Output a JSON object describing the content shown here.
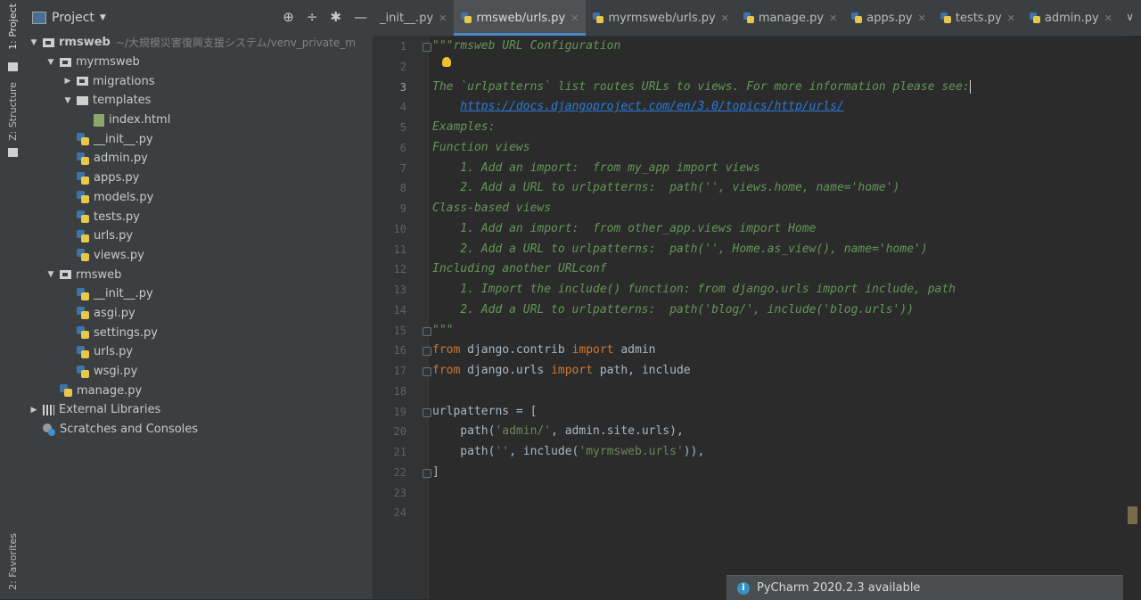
{
  "side_tabs": {
    "project": "1: Project",
    "structure": "Z: Structure",
    "favorites": "2: Favorites"
  },
  "project_panel": {
    "title": "Project",
    "tree": [
      {
        "label": "rmsweb",
        "suffix": "~/大規模災害復興支援システム/venv_private_m",
        "depth": 0,
        "arrow": "down",
        "icon": "folder",
        "bold": true
      },
      {
        "label": "myrmsweb",
        "depth": 1,
        "arrow": "down",
        "icon": "folder"
      },
      {
        "label": "migrations",
        "depth": 2,
        "arrow": "right",
        "icon": "folder"
      },
      {
        "label": "templates",
        "depth": 2,
        "arrow": "down",
        "icon": "folder-plain"
      },
      {
        "label": "index.html",
        "depth": 3,
        "icon": "html"
      },
      {
        "label": "__init__.py",
        "depth": 2,
        "icon": "py"
      },
      {
        "label": "admin.py",
        "depth": 2,
        "icon": "py"
      },
      {
        "label": "apps.py",
        "depth": 2,
        "icon": "py"
      },
      {
        "label": "models.py",
        "depth": 2,
        "icon": "py"
      },
      {
        "label": "tests.py",
        "depth": 2,
        "icon": "py"
      },
      {
        "label": "urls.py",
        "depth": 2,
        "icon": "py"
      },
      {
        "label": "views.py",
        "depth": 2,
        "icon": "py"
      },
      {
        "label": "rmsweb",
        "depth": 1,
        "arrow": "down",
        "icon": "folder"
      },
      {
        "label": "__init__.py",
        "depth": 2,
        "icon": "py"
      },
      {
        "label": "asgi.py",
        "depth": 2,
        "icon": "py"
      },
      {
        "label": "settings.py",
        "depth": 2,
        "icon": "py"
      },
      {
        "label": "urls.py",
        "depth": 2,
        "icon": "py"
      },
      {
        "label": "wsgi.py",
        "depth": 2,
        "icon": "py"
      },
      {
        "label": "manage.py",
        "depth": 1,
        "icon": "py"
      },
      {
        "label": "External Libraries",
        "depth": 0,
        "arrow": "right",
        "icon": "lib"
      },
      {
        "label": "Scratches and Consoles",
        "depth": 0,
        "icon": "scratch"
      }
    ]
  },
  "tabs": [
    {
      "label": "_init__.py",
      "icon": false,
      "active": false
    },
    {
      "label": "rmsweb/urls.py",
      "icon": true,
      "active": true
    },
    {
      "label": "myrmsweb/urls.py",
      "icon": true,
      "active": false
    },
    {
      "label": "manage.py",
      "icon": true,
      "active": false
    },
    {
      "label": "apps.py",
      "icon": true,
      "active": false
    },
    {
      "label": "tests.py",
      "icon": true,
      "active": false
    },
    {
      "label": "admin.py",
      "icon": true,
      "active": false
    }
  ],
  "editor": {
    "current_line": 3,
    "lines": [
      [
        {
          "t": "\"\"\"rmsweb URL Configuration",
          "c": "doc"
        }
      ],
      [],
      [
        {
          "t": "The `urlpatterns` list routes URLs to views. For more information please see:",
          "c": "doc"
        },
        {
          "t": "",
          "c": "caret"
        }
      ],
      [
        {
          "t": "    ",
          "c": "doc"
        },
        {
          "t": "https://docs.djangoproject.com/en/3.0/topics/http/urls/",
          "c": "url"
        }
      ],
      [
        {
          "t": "Examples:",
          "c": "doc"
        }
      ],
      [
        {
          "t": "Function views",
          "c": "doc"
        }
      ],
      [
        {
          "t": "    1. Add an import:  from my_app import views",
          "c": "doc"
        }
      ],
      [
        {
          "t": "    2. Add a URL to urlpatterns:  path('', views.home, name='home')",
          "c": "doc"
        }
      ],
      [
        {
          "t": "Class-based views",
          "c": "doc"
        }
      ],
      [
        {
          "t": "    1. Add an import:  from other_app.views import Home",
          "c": "doc"
        }
      ],
      [
        {
          "t": "    2. Add a URL to urlpatterns:  path('', Home.as_view(), name='home')",
          "c": "doc"
        }
      ],
      [
        {
          "t": "Including another URLconf",
          "c": "doc"
        }
      ],
      [
        {
          "t": "    1. Import the include() function: from django.urls import include, path",
          "c": "doc"
        }
      ],
      [
        {
          "t": "    2. Add a URL to urlpatterns:  path('blog/', include('blog.urls'))",
          "c": "doc"
        }
      ],
      [
        {
          "t": "\"\"\"",
          "c": "doc"
        }
      ],
      [
        {
          "t": "from",
          "c": "kw"
        },
        {
          "t": " django.contrib ",
          "c": "plain"
        },
        {
          "t": "import",
          "c": "kw"
        },
        {
          "t": " admin",
          "c": "plain"
        }
      ],
      [
        {
          "t": "from",
          "c": "kw"
        },
        {
          "t": " django.urls ",
          "c": "plain"
        },
        {
          "t": "import",
          "c": "kw"
        },
        {
          "t": " path, include",
          "c": "plain"
        }
      ],
      [],
      [
        {
          "t": "urlpatterns = [",
          "c": "plain"
        }
      ],
      [
        {
          "t": "    path(",
          "c": "plain"
        },
        {
          "t": "'admin/'",
          "c": "str"
        },
        {
          "t": ", admin.site.urls),",
          "c": "plain"
        }
      ],
      [
        {
          "t": "    path(",
          "c": "plain"
        },
        {
          "t": "''",
          "c": "str"
        },
        {
          "t": ", include(",
          "c": "plain"
        },
        {
          "t": "'myrmsweb.urls'",
          "c": "str"
        },
        {
          "t": ")),",
          "c": "plain"
        }
      ],
      [
        {
          "t": "]",
          "c": "plain"
        }
      ],
      [],
      []
    ],
    "fold_lines": [
      1,
      15,
      16,
      17,
      19,
      22
    ]
  },
  "notification": {
    "text": "PyCharm 2020.2.3 available"
  },
  "colors": {
    "background": "#2b2b2b",
    "panel": "#3c3f41",
    "accent": "#4a88c7",
    "docstring": "#629755",
    "keyword": "#cc7832",
    "string": "#6a8759"
  }
}
